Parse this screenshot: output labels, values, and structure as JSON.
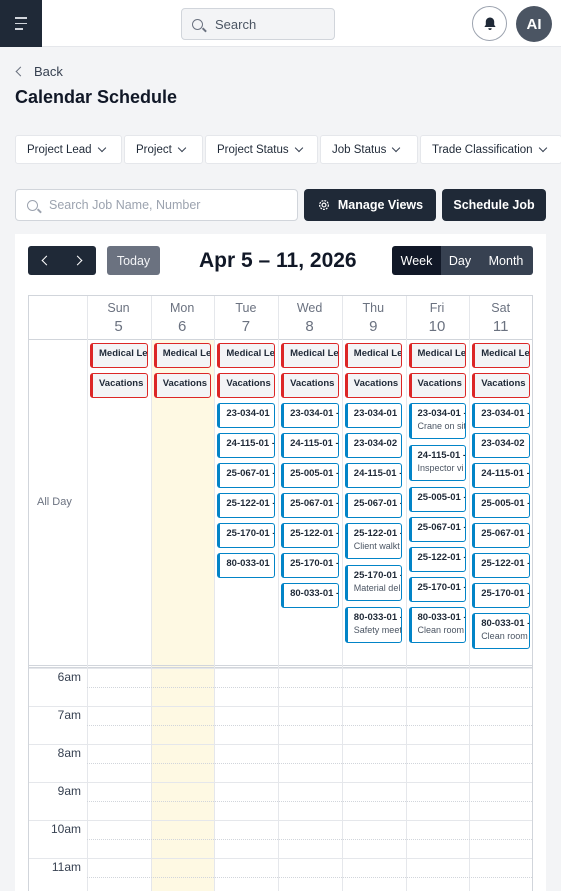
{
  "topbar": {
    "search_placeholder": "Search",
    "avatar_initials": "AI"
  },
  "header": {
    "back_label": "Back",
    "title": "Calendar Schedule"
  },
  "filters": [
    "Project Lead",
    "Project",
    "Project Status",
    "Job Status",
    "Trade Classification"
  ],
  "toolbar": {
    "job_search_placeholder": "Search Job Name, Number",
    "manage_views_label": "Manage Views",
    "schedule_job_label": "Schedule Job"
  },
  "calendar": {
    "today_label": "Today",
    "range_title": "Apr 5 – 11, 2026",
    "views": [
      "Week",
      "Day",
      "Month"
    ],
    "active_view": "Week",
    "all_day_label": "All Day",
    "days": [
      {
        "name": "Sun",
        "date": "5"
      },
      {
        "name": "Mon",
        "date": "6"
      },
      {
        "name": "Tue",
        "date": "7"
      },
      {
        "name": "Wed",
        "date": "8"
      },
      {
        "name": "Thu",
        "date": "9"
      },
      {
        "name": "Fri",
        "date": "10"
      },
      {
        "name": "Sat",
        "date": "11"
      }
    ],
    "hours": [
      "6am",
      "7am",
      "8am",
      "9am",
      "10am",
      "11am"
    ],
    "events": [
      [
        {
          "title": "Medical Lea",
          "type": "leave"
        },
        {
          "title": "Vacations",
          "type": "leave"
        }
      ],
      [
        {
          "title": "Medical Lea",
          "type": "leave"
        },
        {
          "title": "Vacations",
          "type": "leave"
        }
      ],
      [
        {
          "title": "Medical Lea",
          "type": "leave"
        },
        {
          "title": "Vacations",
          "type": "leave"
        },
        {
          "title": "23-034-01",
          "type": "job"
        },
        {
          "title": "24-115-01 -",
          "type": "job"
        },
        {
          "title": "25-067-01 -",
          "type": "job"
        },
        {
          "title": "25-122-01 -",
          "type": "job"
        },
        {
          "title": "25-170-01 -",
          "type": "job"
        },
        {
          "title": "80-033-01",
          "type": "job"
        }
      ],
      [
        {
          "title": "Medical Lea",
          "type": "leave"
        },
        {
          "title": "Vacations",
          "type": "leave"
        },
        {
          "title": "23-034-01 -",
          "type": "job"
        },
        {
          "title": "24-115-01 -",
          "type": "job"
        },
        {
          "title": "25-005-01 -",
          "type": "job"
        },
        {
          "title": "25-067-01 -",
          "type": "job"
        },
        {
          "title": "25-122-01 -",
          "type": "job"
        },
        {
          "title": "25-170-01 -",
          "type": "job"
        },
        {
          "title": "80-033-01 -",
          "type": "job"
        }
      ],
      [
        {
          "title": "Medical Lea",
          "type": "leave"
        },
        {
          "title": "Vacations",
          "type": "leave"
        },
        {
          "title": "23-034-01",
          "type": "job"
        },
        {
          "title": "23-034-02",
          "type": "job"
        },
        {
          "title": "24-115-01 -",
          "type": "job"
        },
        {
          "title": "25-067-01 -",
          "type": "job"
        },
        {
          "title": "25-122-01 -",
          "type": "job",
          "note": "Client walkt"
        },
        {
          "title": "25-170-01 -",
          "type": "job",
          "note": "Material del"
        },
        {
          "title": "80-033-01 -",
          "type": "job",
          "note": "Safety meet"
        }
      ],
      [
        {
          "title": "Medical Lea",
          "type": "leave"
        },
        {
          "title": "Vacations",
          "type": "leave"
        },
        {
          "title": "23-034-01 -",
          "type": "job",
          "note": "Crane on sit"
        },
        {
          "title": "24-115-01 -",
          "type": "job",
          "note": "Inspector vi"
        },
        {
          "title": "25-005-01 -",
          "type": "job"
        },
        {
          "title": "25-067-01 -",
          "type": "job"
        },
        {
          "title": "25-122-01 -",
          "type": "job"
        },
        {
          "title": "25-170-01 -",
          "type": "job"
        },
        {
          "title": "80-033-01 -",
          "type": "job",
          "note": "Clean room"
        }
      ],
      [
        {
          "title": "Medical Lea",
          "type": "leave"
        },
        {
          "title": "Vacations",
          "type": "leave"
        },
        {
          "title": "23-034-01 -",
          "type": "job"
        },
        {
          "title": "23-034-02",
          "type": "job"
        },
        {
          "title": "24-115-01 -",
          "type": "job"
        },
        {
          "title": "25-005-01 -",
          "type": "job"
        },
        {
          "title": "25-067-01 -",
          "type": "job"
        },
        {
          "title": "25-122-01 -",
          "type": "job"
        },
        {
          "title": "25-170-01 -",
          "type": "job"
        },
        {
          "title": "80-033-01 -",
          "type": "job",
          "note": "Clean room"
        }
      ]
    ]
  },
  "colors": {
    "dark": "#1f2937",
    "leave_accent": "#dc2626",
    "job_accent": "#0284c7",
    "today_highlight": "#fef9e3"
  }
}
